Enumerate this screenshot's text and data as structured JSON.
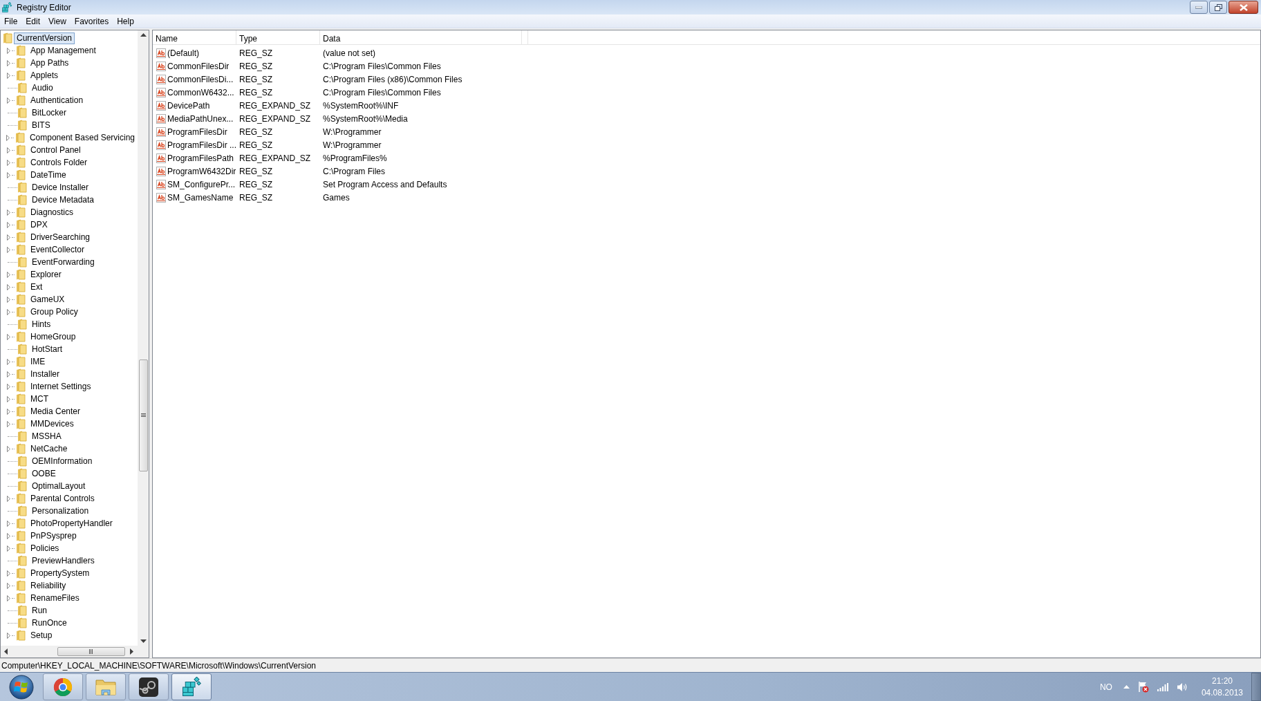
{
  "window": {
    "title": "Registry Editor"
  },
  "menu": [
    "File",
    "Edit",
    "View",
    "Favorites",
    "Help"
  ],
  "tree": {
    "label": "CurrentVersion",
    "selected": true,
    "children": [
      {
        "label": "App Management",
        "expandable": true
      },
      {
        "label": "App Paths",
        "expandable": true
      },
      {
        "label": "Applets",
        "expandable": true
      },
      {
        "label": "Audio",
        "expandable": false
      },
      {
        "label": "Authentication",
        "expandable": true
      },
      {
        "label": "BitLocker",
        "expandable": false
      },
      {
        "label": "BITS",
        "expandable": false
      },
      {
        "label": "Component Based Servicing",
        "expandable": true
      },
      {
        "label": "Control Panel",
        "expandable": true
      },
      {
        "label": "Controls Folder",
        "expandable": true
      },
      {
        "label": "DateTime",
        "expandable": true
      },
      {
        "label": "Device Installer",
        "expandable": false
      },
      {
        "label": "Device Metadata",
        "expandable": false
      },
      {
        "label": "Diagnostics",
        "expandable": true
      },
      {
        "label": "DPX",
        "expandable": true
      },
      {
        "label": "DriverSearching",
        "expandable": true
      },
      {
        "label": "EventCollector",
        "expandable": true
      },
      {
        "label": "EventForwarding",
        "expandable": false
      },
      {
        "label": "Explorer",
        "expandable": true
      },
      {
        "label": "Ext",
        "expandable": true
      },
      {
        "label": "GameUX",
        "expandable": true
      },
      {
        "label": "Group Policy",
        "expandable": true
      },
      {
        "label": "Hints",
        "expandable": false
      },
      {
        "label": "HomeGroup",
        "expandable": true
      },
      {
        "label": "HotStart",
        "expandable": false
      },
      {
        "label": "IME",
        "expandable": true
      },
      {
        "label": "Installer",
        "expandable": true
      },
      {
        "label": "Internet Settings",
        "expandable": true
      },
      {
        "label": "MCT",
        "expandable": true
      },
      {
        "label": "Media Center",
        "expandable": true
      },
      {
        "label": "MMDevices",
        "expandable": true
      },
      {
        "label": "MSSHA",
        "expandable": false
      },
      {
        "label": "NetCache",
        "expandable": true
      },
      {
        "label": "OEMInformation",
        "expandable": false
      },
      {
        "label": "OOBE",
        "expandable": false
      },
      {
        "label": "OptimalLayout",
        "expandable": false
      },
      {
        "label": "Parental Controls",
        "expandable": true
      },
      {
        "label": "Personalization",
        "expandable": false
      },
      {
        "label": "PhotoPropertyHandler",
        "expandable": true
      },
      {
        "label": "PnPSysprep",
        "expandable": true
      },
      {
        "label": "Policies",
        "expandable": true
      },
      {
        "label": "PreviewHandlers",
        "expandable": false
      },
      {
        "label": "PropertySystem",
        "expandable": true
      },
      {
        "label": "Reliability",
        "expandable": true
      },
      {
        "label": "RenameFiles",
        "expandable": true
      },
      {
        "label": "Run",
        "expandable": false
      },
      {
        "label": "RunOnce",
        "expandable": false
      },
      {
        "label": "Setup",
        "expandable": true
      }
    ]
  },
  "values": {
    "columns": [
      "Name",
      "Type",
      "Data"
    ],
    "rows": [
      {
        "name": "(Default)",
        "type": "REG_SZ",
        "data": "(value not set)"
      },
      {
        "name": "CommonFilesDir",
        "type": "REG_SZ",
        "data": "C:\\Program Files\\Common Files"
      },
      {
        "name": "CommonFilesDi...",
        "type": "REG_SZ",
        "data": "C:\\Program Files (x86)\\Common Files"
      },
      {
        "name": "CommonW6432...",
        "type": "REG_SZ",
        "data": "C:\\Program Files\\Common Files"
      },
      {
        "name": "DevicePath",
        "type": "REG_EXPAND_SZ",
        "data": "%SystemRoot%\\INF"
      },
      {
        "name": "MediaPathUnex...",
        "type": "REG_EXPAND_SZ",
        "data": "%SystemRoot%\\Media"
      },
      {
        "name": "ProgramFilesDir",
        "type": "REG_SZ",
        "data": "W:\\Programmer"
      },
      {
        "name": "ProgramFilesDir ...",
        "type": "REG_SZ",
        "data": "W:\\Programmer"
      },
      {
        "name": "ProgramFilesPath",
        "type": "REG_EXPAND_SZ",
        "data": "%ProgramFiles%"
      },
      {
        "name": "ProgramW6432Dir",
        "type": "REG_SZ",
        "data": "C:\\Program Files"
      },
      {
        "name": "SM_ConfigurePr...",
        "type": "REG_SZ",
        "data": "Set Program Access and Defaults"
      },
      {
        "name": "SM_GamesName",
        "type": "REG_SZ",
        "data": "Games"
      }
    ]
  },
  "status_bar": "Computer\\HKEY_LOCAL_MACHINE\\SOFTWARE\\Microsoft\\Windows\\CurrentVersion",
  "taskbar": {
    "apps": [
      {
        "kind": "browser",
        "active": false
      },
      {
        "kind": "folder",
        "active": false
      },
      {
        "kind": "steam",
        "active": false
      },
      {
        "kind": "registry",
        "active": true
      }
    ],
    "tray": {
      "language": "NO",
      "time": "21:20",
      "date": "04.08.2013"
    }
  }
}
